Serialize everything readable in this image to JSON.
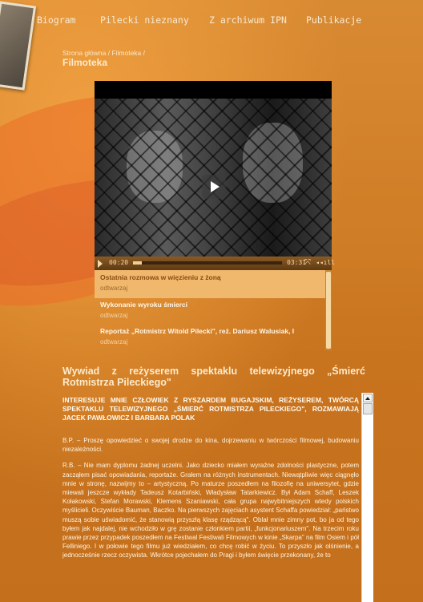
{
  "nav": {
    "items": [
      {
        "label": "Biogram"
      },
      {
        "label": "Pilecki nieznany"
      },
      {
        "label": "Z archiwum IPN"
      },
      {
        "label": "Publikacje"
      }
    ]
  },
  "breadcrumb": {
    "home": "Strona główna",
    "sep1": " / ",
    "section": "Filmoteka",
    "sep2": " /"
  },
  "page": {
    "title": "Filmoteka"
  },
  "player": {
    "time_current": "00:20",
    "time_total": "03:31",
    "progress": 0.06,
    "fullscreen_icon": "fullscreen-icon",
    "volume_icon": "volume-icon"
  },
  "playlist": {
    "items": [
      {
        "title": "Ostatnia rozmowa w więzieniu z żoną",
        "sub": "odtwarzaj",
        "active": true
      },
      {
        "title": "Wykonanie wyroku śmierci",
        "sub": "odtwarzaj",
        "active": false
      },
      {
        "title": "Reportaż „Rotmistrz Witold Pilecki\", reż. Dariusz Walusiak, I",
        "sub": "odtwarzaj",
        "active": false
      }
    ]
  },
  "article": {
    "title": "Wywiad z reżyserem spektaklu telewizyjnego „Śmierć Rotmistrza Pileckiego\"",
    "heading": "INTERESUJE MNIE CZŁOWIEK Z RYSZARDEM BUGAJSKIM, REŻYSEREM, TWÓRCĄ SPEKTAKLU TELEWIZYJNEGO „ŚMIERĆ ROTMISTRZA PILECKIEGO\", ROZMAWIAJĄ JACEK PAWŁOWICZ I BARBARA POLAK",
    "p1": "B.P. – Proszę opowiedzieć o swojej drodze do kina, dojrzewaniu w twórczości filmowej, budowaniu niezależności.",
    "p2": "R.B. – Nie mam dyplomu żadnej uczelni. Jako dziecko miałem wyraźne zdolności plastyczne, potem zacząłem pisać opowiadania, reportaże. Grałem na różnych instrumentach. Niewątpliwie więc ciągnęło mnie w stronę, nazwijmy to – artystyczną. Po maturze poszedłem na filozofię na uniwersytet, gdzie miewali jeszcze wykłady Tadeusz Kotarbiński, Władysław Tatarkiewicz. Był Adam Schaff, Leszek Kołakowski, Stefan Morawski, Klemens Szaniawski, cała grupa najwybitniejszych wtedy polskich myślicieli. Oczywiście Bauman, Baczko. Na pierwszych zajęciach asystent Schaffa powiedział: „państwo muszą sobie uświadomić, że stanowią przyszłą klasę rządzącą\". Oblał mnie zimny pot, bo ja od tego byłem jak najdalej, nie wchodziło w grę zostanie członkiem partii, „funkcjonariuszem\". Na trzecim roku prawie przez przypadek poszedłem na Festiwal Festiwali Filmowych w kinie „Skarpa\" na film Osiem i pół Felliniego. I w połowie tego filmu już wiedziałem, co chcę robić w życiu. To przyszło jak olśnienie, a jednocześnie rzecz oczywista. Wkrótce pojechałem do Pragi i byłem święcie przekonany, że to"
  }
}
